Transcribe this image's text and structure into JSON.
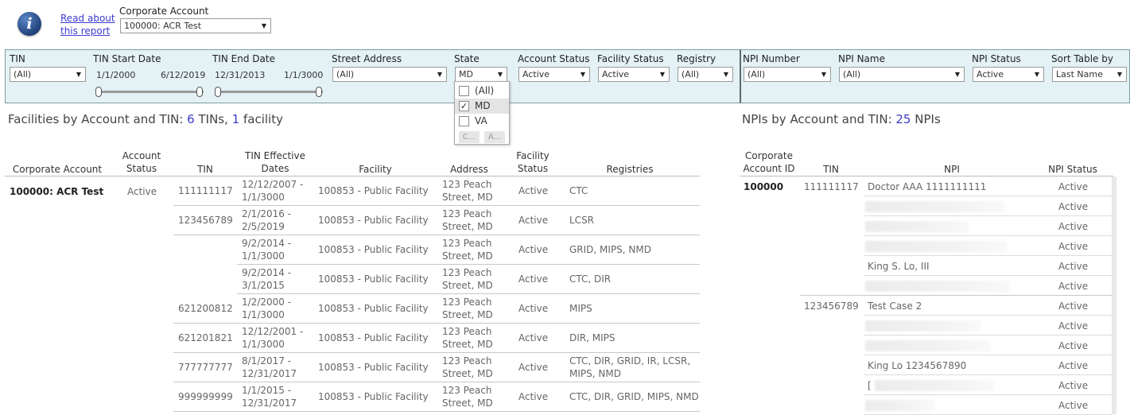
{
  "header": {
    "info_icon": "info-icon",
    "read_link": "Read about this report",
    "corporate_account_label": "Corporate Account",
    "corporate_account_value": "100000: ACR Test"
  },
  "filters": {
    "tin": {
      "label": "TIN",
      "value": "(All)"
    },
    "tin_start": {
      "label": "TIN Start Date",
      "from": "1/1/2000",
      "to": "6/12/2019"
    },
    "tin_end": {
      "label": "TIN End Date",
      "from": "12/31/2013",
      "to": "1/1/3000"
    },
    "street": {
      "label": "Street Address",
      "value": "(All)"
    },
    "state": {
      "label": "State",
      "value": "MD",
      "options": [
        {
          "label": "(All)",
          "checked": false
        },
        {
          "label": "MD",
          "checked": true
        },
        {
          "label": "VA",
          "checked": false
        }
      ],
      "button_1": "C...",
      "button_2": "A..."
    },
    "account_status": {
      "label": "Account Status",
      "value": "Active"
    },
    "facility_status": {
      "label": "Facility Status",
      "value": "Active"
    },
    "registry": {
      "label": "Registry",
      "value": "(All)"
    },
    "npi_number": {
      "label": "NPI Number",
      "value": "(All)"
    },
    "npi_name": {
      "label": "NPI Name",
      "value": "(All)"
    },
    "npi_status": {
      "label": "NPI Status",
      "value": "Active"
    },
    "sort": {
      "label": "Sort Table by",
      "value": "Last Name"
    }
  },
  "facilities": {
    "title_prefix": "Facilities by Account and TIN: ",
    "tin_count": "6",
    "tin_word": " TINs, ",
    "facility_count": "1",
    "facility_word": " facility",
    "headers": {
      "corporate_account": "Corporate Account",
      "account_status_1": "Account",
      "account_status_2": "Status",
      "tin": "TIN",
      "dates_1": "TIN Effective",
      "dates_2": "Dates",
      "facility": "Facility",
      "address": "Address",
      "facility_status_1": "Facility",
      "facility_status_2": "Status",
      "registries": "Registries"
    },
    "account": "100000: ACR Test",
    "account_status": "Active",
    "rows": [
      {
        "tin": "111111117",
        "d1": "12/12/2007 -",
        "d2": "1/1/3000",
        "facility": "100853 - Public Facility",
        "a1": "123 Peach",
        "a2": "Street, MD",
        "status": "Active",
        "r1": "CTC",
        "r2": ""
      },
      {
        "tin": "123456789",
        "d1": "2/1/2016 -",
        "d2": "2/5/2019",
        "facility": "100853 - Public Facility",
        "a1": "123 Peach",
        "a2": "Street, MD",
        "status": "Active",
        "r1": "LCSR",
        "r2": ""
      },
      {
        "tin": "",
        "d1": "9/2/2014 -",
        "d2": "1/1/3000",
        "facility": "100853 - Public Facility",
        "a1": "123 Peach",
        "a2": "Street, MD",
        "status": "Active",
        "r1": "GRID, MIPS, NMD",
        "r2": ""
      },
      {
        "tin": "",
        "d1": "9/2/2014 -",
        "d2": "3/1/2015",
        "facility": "100853 - Public Facility",
        "a1": "123 Peach",
        "a2": "Street, MD",
        "status": "Active",
        "r1": "CTC, DIR",
        "r2": ""
      },
      {
        "tin": "621200812",
        "d1": "1/2/2000 -",
        "d2": "1/1/3000",
        "facility": "100853 - Public Facility",
        "a1": "123 Peach",
        "a2": "Street, MD",
        "status": "Active",
        "r1": "MIPS",
        "r2": ""
      },
      {
        "tin": "621201821",
        "d1": "12/12/2001 -",
        "d2": "1/1/3000",
        "facility": "100853 - Public Facility",
        "a1": "123 Peach",
        "a2": "Street, MD",
        "status": "Active",
        "r1": "DIR, MIPS",
        "r2": ""
      },
      {
        "tin": "777777777",
        "d1": "8/1/2017 -",
        "d2": "12/31/2017",
        "facility": "100853 - Public Facility",
        "a1": "123 Peach",
        "a2": "Street, MD",
        "status": "Active",
        "r1": "CTC, DIR, GRID, IR, LCSR,",
        "r2": "MIPS, NMD"
      },
      {
        "tin": "999999999",
        "d1": "1/1/2015 -",
        "d2": "12/31/2017",
        "facility": "100853 - Public Facility",
        "a1": "123 Peach",
        "a2": "Street, MD",
        "status": "Active",
        "r1": "CTC, DIR, GRID, MIPS, NMD",
        "r2": ""
      }
    ]
  },
  "npis": {
    "title_prefix": "NPIs by Account and TIN: ",
    "count": "25",
    "word": " NPIs",
    "headers": {
      "acct_1": "Corporate",
      "acct_2": "Account ID",
      "tin": "TIN",
      "npi": "NPI",
      "status": "NPI Status"
    },
    "account_id": "100000",
    "rows": [
      {
        "tin": "111111117",
        "npi": "Doctor AAA 1111111111",
        "status": "Active"
      },
      {
        "tin": "",
        "npi": "",
        "status": "Active"
      },
      {
        "tin": "",
        "npi": "",
        "status": "Active"
      },
      {
        "tin": "",
        "npi": "",
        "status": "Active"
      },
      {
        "tin": "",
        "npi": "King S. Lo, III",
        "status": "Active"
      },
      {
        "tin": "",
        "npi": "",
        "status": "Active"
      },
      {
        "tin": "123456789",
        "npi": "Test Case 2",
        "status": "Active"
      },
      {
        "tin": "",
        "npi": "",
        "status": "Active"
      },
      {
        "tin": "",
        "npi": "",
        "status": "Active"
      },
      {
        "tin": "",
        "npi": "King Lo 1234567890",
        "status": "Active"
      },
      {
        "tin": "",
        "npi": "[",
        "status": "Active"
      },
      {
        "tin": "",
        "npi": "",
        "status": "Active"
      }
    ]
  }
}
